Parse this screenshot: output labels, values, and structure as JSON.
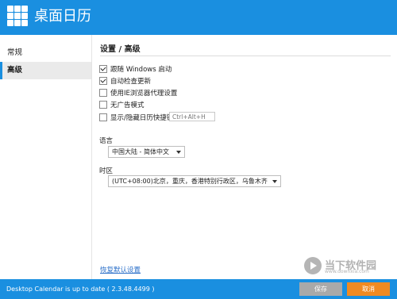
{
  "app": {
    "title": "桌面日历"
  },
  "sidebar": {
    "items": [
      {
        "label": "常规"
      },
      {
        "label": "高级"
      }
    ]
  },
  "main": {
    "section_title": "设置 / 高级",
    "options": [
      {
        "label": "跟随 Windows 启动",
        "checked": true
      },
      {
        "label": "自动检查更新",
        "checked": true
      },
      {
        "label": "使用IE浏览器代理设置",
        "checked": false
      },
      {
        "label": "无广告模式",
        "checked": false
      },
      {
        "label": "显示/隐藏日历快捷键",
        "checked": false
      }
    ],
    "hotkey_placeholder": "Ctrl+Alt+H",
    "language": {
      "label": "语言",
      "value": "中国大陆 - 简体中文"
    },
    "timezone": {
      "label": "时区",
      "value": "(UTC+08:00)北京，重庆，香港特别行政区，乌鲁木齐"
    },
    "reset_link": "恢复默认设置"
  },
  "footer": {
    "status": "Desktop Calendar is up to date ( 2.3.48.4499 )",
    "save_label": "保存",
    "cancel_label": "取消"
  },
  "watermark": {
    "text": "当下软件园",
    "url": "www.downxia.com"
  },
  "colors": {
    "accent": "#1a8fe0",
    "cancel": "#f08a22",
    "save_disabled": "#a9a9a9"
  }
}
